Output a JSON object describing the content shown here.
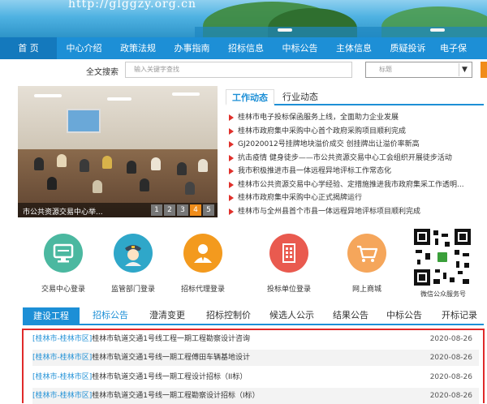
{
  "header": {
    "url": "http://glggzy.org.cn"
  },
  "nav": {
    "items": [
      "首 页",
      "中心介绍",
      "政策法规",
      "办事指南",
      "招标信息",
      "中标公告",
      "主体信息",
      "质疑投诉",
      "电子保"
    ]
  },
  "search": {
    "label": "全文搜索",
    "placeholder": "输入关键字查找",
    "select_value": "标题",
    "select_arrow": "▼"
  },
  "slideshow": {
    "caption": "市公共资源交易中心举...",
    "pages": [
      "1",
      "2",
      "3",
      "4",
      "5"
    ],
    "active_page": "4"
  },
  "news": {
    "tabs": [
      "工作动态",
      "行业动态"
    ],
    "items": [
      "桂林市电子投标保函服务上线，全面助力企业发展",
      "桂林市政府集中采购中心首个政府采购项目顺利完成",
      "GJ2020012号挂牌地块溢价成交 创挂牌出让溢价率新高",
      "抗击疫情 健身徒步——市公共资源交易中心工会组织开展徒步活动",
      "我市积极推进市县一体远程异地评标工作常态化",
      "桂林市公共资源交易中心学经验、定措施推进我市政府集采工作透明...",
      "桂林市政府集中采购中心正式揭牌运行",
      "桂林市与全州县首个市县一体远程异地评标项目顺利完成"
    ]
  },
  "quick_links": [
    {
      "label": "交易中心登录",
      "icon": "monitor-icon",
      "color": "#4bb8a0"
    },
    {
      "label": "监管部门登录",
      "icon": "officer-icon",
      "color": "#2fa7c9"
    },
    {
      "label": "招标代理登录",
      "icon": "agent-person-icon",
      "color": "#f39a1e"
    },
    {
      "label": "投标单位登录",
      "icon": "building-icon",
      "color": "#e95a4f"
    },
    {
      "label": "网上商城",
      "icon": "shopping-cart-icon",
      "color": "#f5a65b"
    }
  ],
  "qr": {
    "label": "微信公众服务号"
  },
  "project_tabs": [
    "建设工程",
    "招标公告",
    "澄清变更",
    "招标控制价",
    "候选人公示",
    "结果公告",
    "中标公告",
    "开标记录"
  ],
  "projects": [
    {
      "region": "[桂林市-桂林市区]",
      "title": "桂林市轨道交通1号线工程一期工程勘察设计咨询",
      "date": "2020-08-26"
    },
    {
      "region": "[桂林市-桂林市区]",
      "title": "桂林市轨道交通1号线一期工程傅田车辆基地设计",
      "date": "2020-08-26"
    },
    {
      "region": "[桂林市-桂林市区]",
      "title": "桂林市轨道交通1号线一期工程设计招标（II标）",
      "date": "2020-08-26"
    },
    {
      "region": "[桂林市-桂林市区]",
      "title": "桂林市轨道交通1号线一期工程勘察设计招标（I标）",
      "date": "2020-08-26"
    }
  ]
}
